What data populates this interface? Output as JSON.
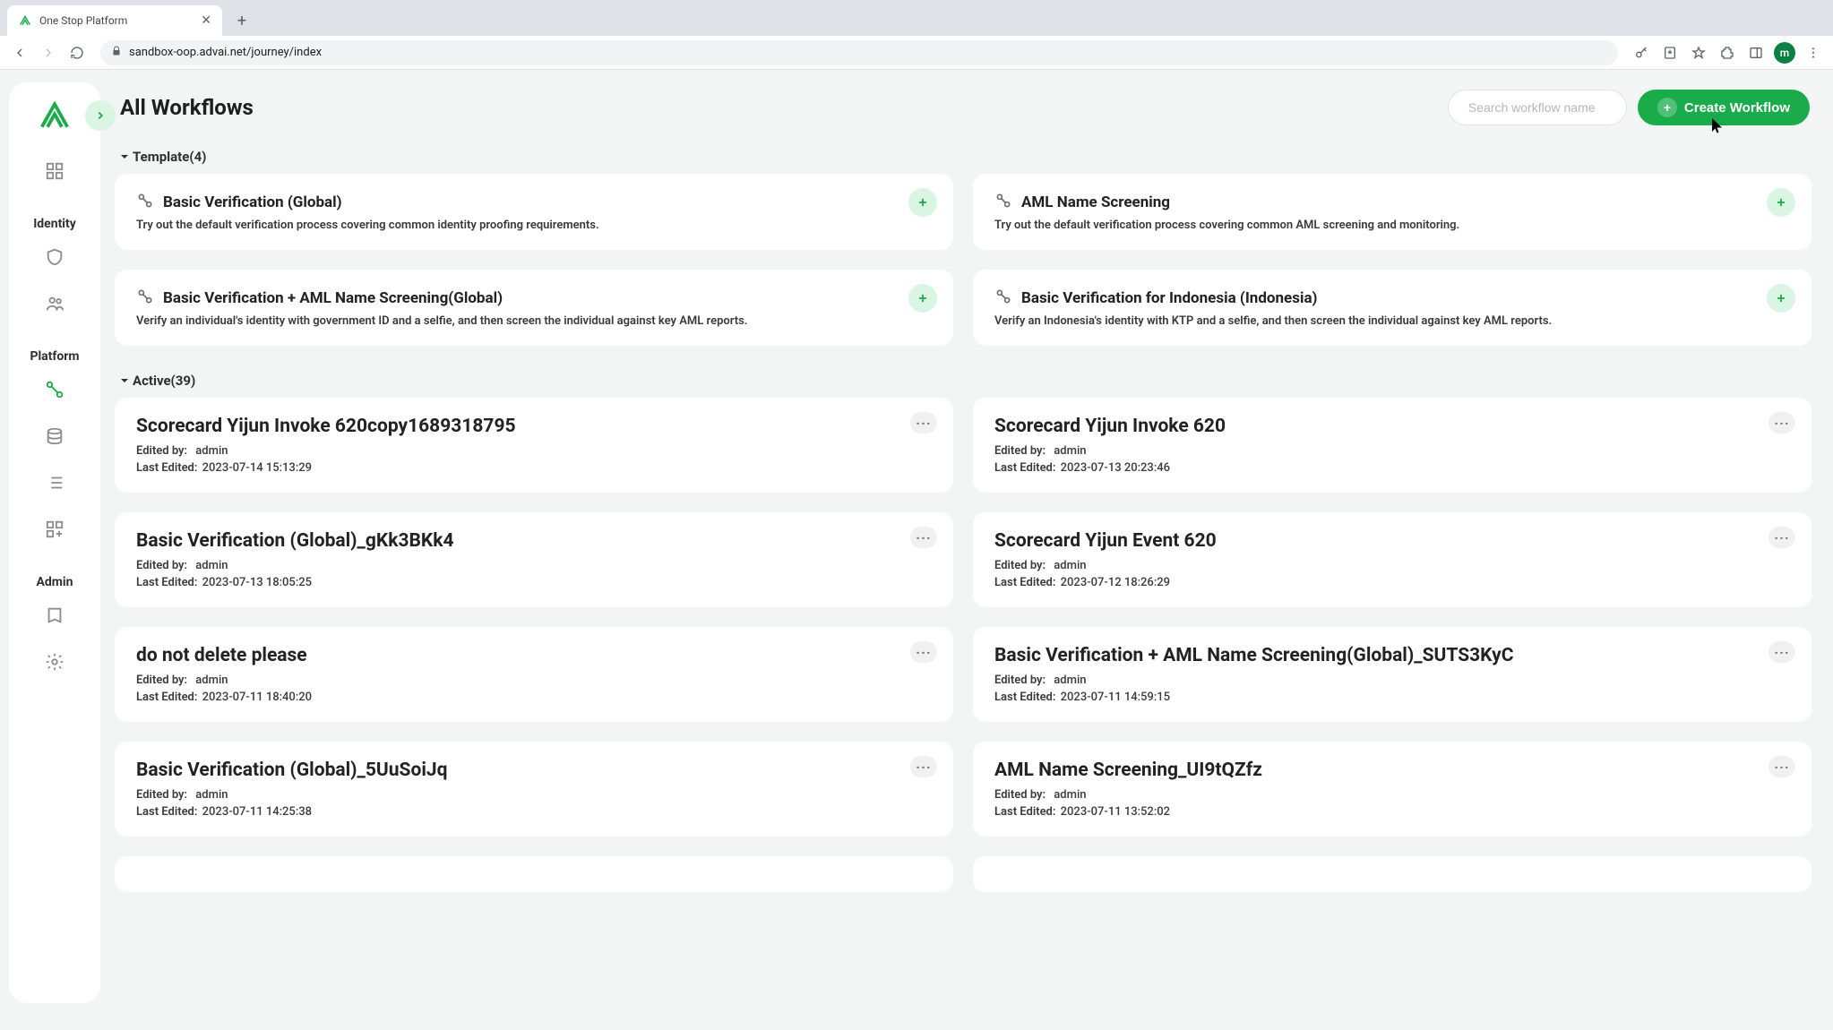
{
  "browser": {
    "tab_title": "One Stop Platform",
    "url": "sandbox-oop.advai.net/journey/index",
    "avatar_letter": "m"
  },
  "sidebar": {
    "sections": {
      "identity": "Identity",
      "platform": "Platform",
      "admin": "Admin"
    }
  },
  "header": {
    "title": "All Workflows",
    "search_placeholder": "Search workflow name",
    "create_label": "Create Workflow"
  },
  "section_labels": {
    "template": "Template(4)",
    "active": "Active(39)"
  },
  "meta_labels": {
    "edited_by": "Edited by:",
    "last_edited": "Last Edited:"
  },
  "templates": [
    {
      "title": "Basic Verification (Global)",
      "desc": "Try out the default verification process covering common identity proofing requirements."
    },
    {
      "title": "AML Name Screening",
      "desc": "Try out the default verification process covering common AML screening and monitoring."
    },
    {
      "title": "Basic Verification + AML Name Screening(Global)",
      "desc": "Verify an individual's identity with government ID and a selfie, and then screen the individual against key AML reports."
    },
    {
      "title": "Basic Verification for Indonesia (Indonesia)",
      "desc": "Verify an Indonesia's identity with KTP and a selfie, and then screen the individual against key AML reports."
    }
  ],
  "active": [
    {
      "title": "Scorecard Yijun Invoke 620copy1689318795",
      "edited_by": "admin",
      "last_edited": "2023-07-14 15:13:29"
    },
    {
      "title": "Scorecard Yijun Invoke 620",
      "edited_by": "admin",
      "last_edited": "2023-07-13 20:23:46"
    },
    {
      "title": "Basic Verification (Global)_gKk3BKk4",
      "edited_by": "admin",
      "last_edited": "2023-07-13 18:05:25"
    },
    {
      "title": "Scorecard Yijun Event 620",
      "edited_by": "admin",
      "last_edited": "2023-07-12 18:26:29"
    },
    {
      "title": "do not delete please",
      "edited_by": "admin",
      "last_edited": "2023-07-11 18:40:20"
    },
    {
      "title": "Basic Verification + AML Name Screening(Global)_SUTS3KyC",
      "edited_by": "admin",
      "last_edited": "2023-07-11 14:59:15"
    },
    {
      "title": "Basic Verification (Global)_5UuSoiJq",
      "edited_by": "admin",
      "last_edited": "2023-07-11 14:25:38"
    },
    {
      "title": "AML Name Screening_UI9tQZfz",
      "edited_by": "admin",
      "last_edited": "2023-07-11 13:52:02"
    }
  ]
}
